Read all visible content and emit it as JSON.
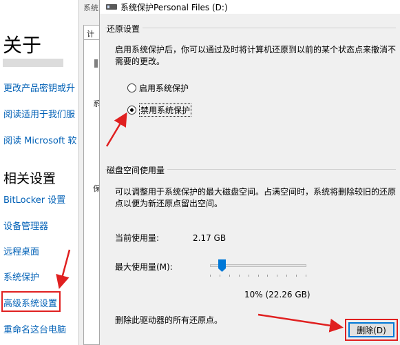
{
  "settings": {
    "about_title": "关于",
    "links": [
      "更改产品密钥或升",
      "阅读适用于我们服",
      "阅读 Microsoft 软"
    ],
    "related_title": "相关设置",
    "related_links": [
      "BitLocker 设置",
      "设备管理器",
      "远程桌面",
      "系统保护",
      "高级系统设置",
      "重命名这台电脑"
    ]
  },
  "parent_dialog": {
    "title": "系统",
    "tab": "计",
    "glyph_1": "系",
    "glyph_2": "保"
  },
  "dialog": {
    "title": "系统保护Personal Files (D:)",
    "restore_group": "还原设置",
    "restore_desc": "启用系统保护后，你可以通过及时将计算机还原到以前的某个状态点来撤消不需要的更改。",
    "radio_enable": "启用系统保护",
    "radio_disable": "禁用系统保护",
    "selected": "disable",
    "disk_group": "磁盘空间使用量",
    "disk_desc": "可以调整用于系统保护的最大磁盘空间。占满空间时，系统将删除较旧的还原点以便为新还原点留出空间。",
    "current_usage_label": "当前使用量:",
    "current_usage_value": "2.17 GB",
    "max_usage_label": "最大使用量(M):",
    "max_usage_value": "10% (22.26 GB)",
    "max_usage_fraction": 0.1,
    "delete_desc": "删除此驱动器的所有还原点。",
    "delete_button": "删除(D)"
  },
  "colors": {
    "link": "#0060b6",
    "annotation_red": "#e02020",
    "accent": "#0078d7"
  }
}
